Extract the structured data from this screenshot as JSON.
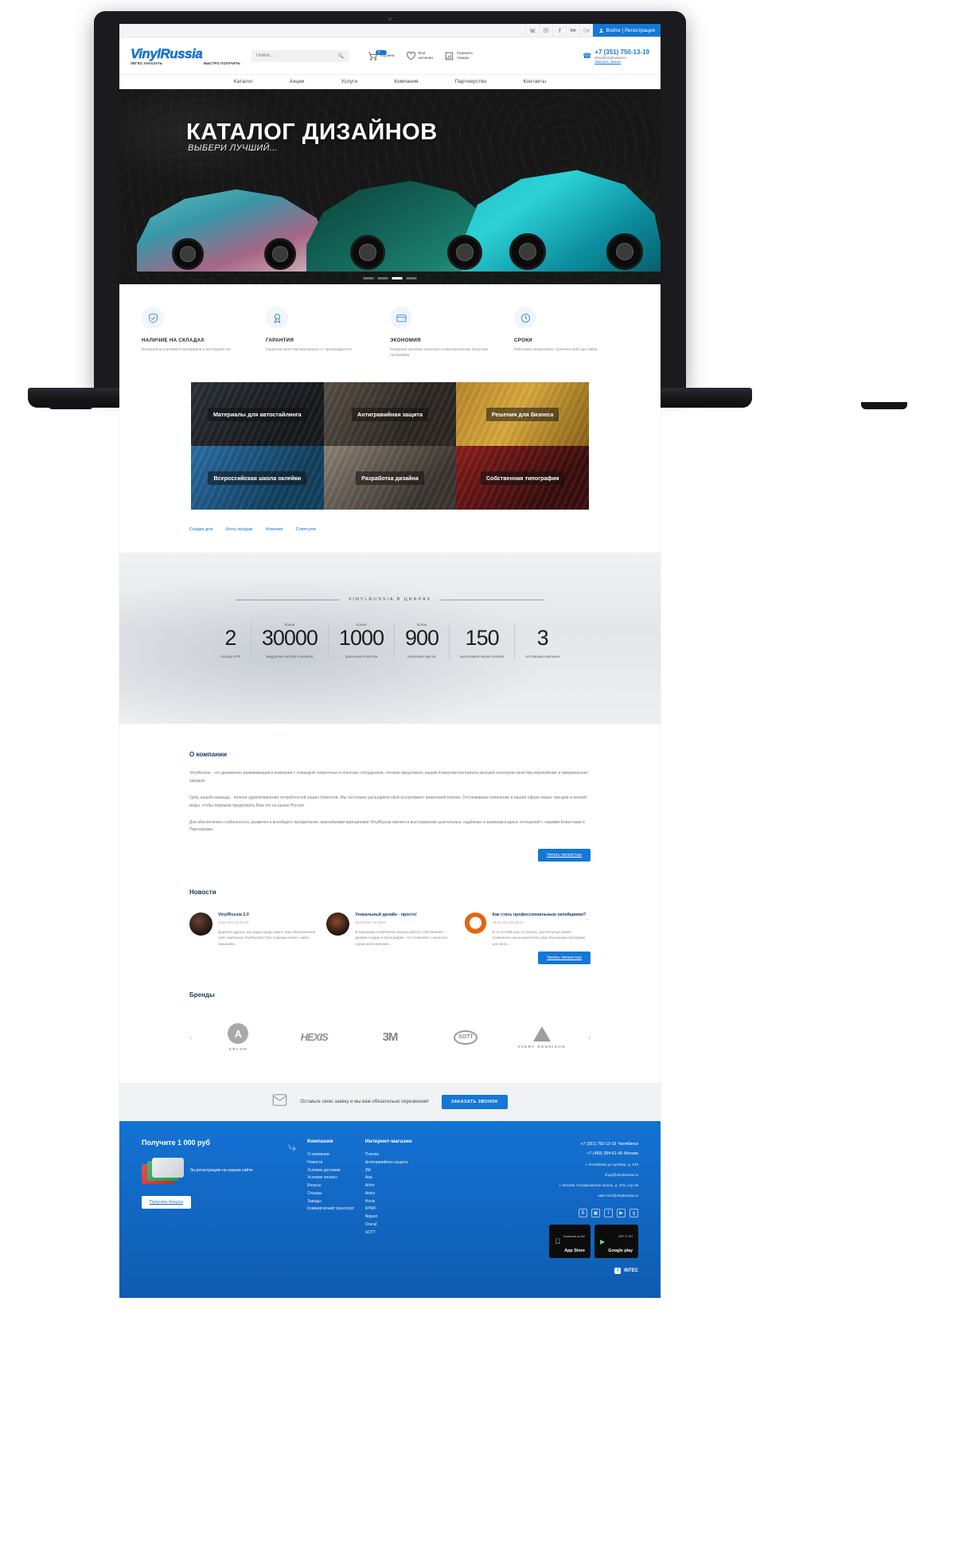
{
  "topbar": {
    "social": [
      "vk-icon",
      "instagram-icon",
      "facebook-icon",
      "youtube-icon",
      "google-plus-icon"
    ],
    "login_label": "Войти | Регистрация"
  },
  "header": {
    "logo_text": "VinylRussia",
    "logo_tag_left": "ЛЕГКО ЗАКАЗАТЬ",
    "logo_tag_right": "БЫСТРО ПОЛУЧИТЬ",
    "search_placeholder": "Поиск...",
    "cart": {
      "label": "Корзина",
      "count": "0"
    },
    "wishlist": {
      "line1": "Мои",
      "line2": "желания"
    },
    "compare": {
      "line1": "Сравнить",
      "line2": "товары"
    },
    "phone": "+7 (351) 750-13-19",
    "email": "shop@vinylrussia.ru",
    "callback_link": "Заказать звонок"
  },
  "nav": [
    "Каталог",
    "Акции",
    "Услуги",
    "Компания",
    "Партнерство",
    "Контакты"
  ],
  "hero": {
    "title": "КАТАЛОГ ДИЗАЙНОВ",
    "subtitle": "ВЫБЕРИ ЛУЧШИЙ...",
    "dots_total": 4,
    "dots_active": 3
  },
  "features": [
    {
      "icon": "shield-check-icon",
      "title": "НАЛИЧИЕ НА СКЛАДАХ",
      "text": "Большой ассортимент материала и инструментов"
    },
    {
      "icon": "award-ribbon-icon",
      "title": "ГАРАНТИЯ",
      "text": "Гарантия качества материала от производителя"
    },
    {
      "icon": "wallet-icon",
      "title": "ЭКОНОМИЯ",
      "text": "Разумная ценовая политика и накопительная бонусная программа"
    },
    {
      "icon": "clock-icon",
      "title": "СРОКИ",
      "text": "Работаем оперативно. Срочная либо доставка"
    }
  ],
  "tiles": [
    {
      "label": "Материалы для автостайлинга"
    },
    {
      "label": "Антигравийная защита"
    },
    {
      "label": "Решения для бизнеса"
    },
    {
      "label": "Всероссийская школа оклейки"
    },
    {
      "label": "Разработка дизайна"
    },
    {
      "label": "Собственная типография"
    }
  ],
  "product_tabs": [
    "Скидки дня",
    "Хиты продаж",
    "Новинки",
    "Советуем"
  ],
  "numbers": {
    "title": "VINYLRUSSIA В ЦИФРАХ",
    "items": [
      {
        "prefix": "",
        "value": "2",
        "label": "Склада в РФ"
      },
      {
        "prefix": "более",
        "value": "30000",
        "label": "квадратных метров в наличии"
      },
      {
        "prefix": "более",
        "value": "1000",
        "label": "довольных клиентов"
      },
      {
        "prefix": "более",
        "value": "900",
        "label": "различных цветов"
      },
      {
        "prefix": "",
        "value": "150",
        "label": "выпускников нашей оклейки"
      },
      {
        "prefix": "",
        "value": "3",
        "label": "поставщика компании"
      }
    ]
  },
  "about": {
    "heading": "О компании",
    "paragraphs": [
      "VinylRussia - это динамично развивающаяся компания с командой энергичных и опытных сотрудников, готовая предложить нашим Клиентам материалы высшей категории качества европейских и американских заводов.",
      "Цель нашей команды - полное удовлетворение потребностей наших Клиентов. Мы постоянно расширяем свой ассортимент виниловой пленки. Отслеживаем появление в нашей сфере новых трендов и веяний моды, чтобы первыми предложить Вам это на рынке России.",
      "Для обеспечения стабильности, развития и всеобщего процветания, важнейшими принципами VinylRussia является выстраивание длительных, надёжных и взаимовыгодных отношений с нашими Клиентами и Партнёрами."
    ],
    "more_label": "Читать полностью"
  },
  "news": {
    "heading": "Новости",
    "more_label": "Читать полностью",
    "items": [
      {
        "title": "VinylRussia 2.0",
        "date": "18.04.2017 22:51:03",
        "text": "Дорогие друзья, мы рады представить вам обновленный сайт компании VinylRussia! При помощи нового сайта признаём..."
      },
      {
        "title": "Уникальный дизайн - просто!",
        "date": "18.04.2017 22:38:59",
        "text": "В компании VinylRussia начала работу собственная дизайн-студия и типография, что позволяет сократить сроки изготовления..."
      },
      {
        "title": "Как стать профессиональным оклейщиком?",
        "date": "18.04.2017 22:30:24",
        "text": "6-ти летний опыт и успехи, достигнутые ранее, позволили нам разработать ряд обучающих программ для всех ..."
      }
    ]
  },
  "brands": {
    "heading": "Бренды",
    "prev": "‹",
    "next": "›",
    "items": [
      {
        "name": "ARLON",
        "mark": "A"
      },
      {
        "name": "HEXIS",
        "mark": "HEXIS"
      },
      {
        "name": "3M",
        "mark": "3M"
      },
      {
        "name": "SOTT",
        "mark": "SOTT"
      },
      {
        "name": "AVERY DENNISON",
        "mark": "AVERY"
      }
    ]
  },
  "callback": {
    "icon": "envelope-icon",
    "text": "Оставьте свою заявку и мы вам обязательно перезвоним!",
    "button": "ЗАКАЗАТЬ ЗВОНОК"
  },
  "footer": {
    "bonus": {
      "title": "Получите 1 000 руб",
      "text": "За регистрацию на нашем сайте",
      "button": "Получить бонусы"
    },
    "company": {
      "heading": "Компания",
      "links": [
        "О компании",
        "Новости",
        "Условия доставки",
        "Условия оплаты",
        "Бонусы",
        "Отзывы",
        "Заводы",
        "Коммерческий транспорт"
      ]
    },
    "shop": {
      "heading": "Интернет-магазин",
      "links": [
        "Пленка",
        "Антигравийная защита",
        "3M",
        "Apa",
        "Arlon",
        "Avery",
        "Hexis",
        "KPMF",
        "Nippon",
        "Oracal",
        "SOTT"
      ]
    },
    "contacts": {
      "phone1": "+7 (351) 750-13-19",
      "city1": "Челябинск",
      "phone2": "+7 (499) 394-61-49",
      "city2": "Москва",
      "addr1": "г. Челябинск ул.Артёма, д. 133",
      "mail1": "shop@vinylrussia.ru",
      "addr2": "г. Москва Алтуфьевское шоссе, д. 37а, стр.19",
      "mail2": "sale.msc@vinylrussia.ru",
      "social": [
        "vk-icon",
        "instagram-icon",
        "facebook-icon",
        "youtube-icon",
        "google-plus-icon"
      ],
      "stores": [
        {
          "small": "Download on the",
          "big": "App Store"
        },
        {
          "small": "GET IT ON",
          "big": "Google play"
        }
      ],
      "agency": "INTEC"
    }
  }
}
